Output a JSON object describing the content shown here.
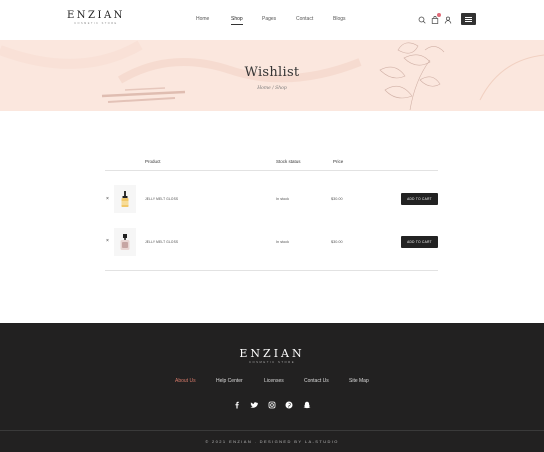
{
  "header": {
    "logo": "ENZIAN",
    "logo_tagline": "COSMETIC STORE",
    "nav": [
      "Home",
      "Shop",
      "Pages",
      "Contact",
      "Blogs"
    ],
    "active_nav": "Shop",
    "icons": [
      "search-icon",
      "cart-icon",
      "user-icon",
      "menu-icon"
    ]
  },
  "banner": {
    "title": "Wishlist",
    "breadcrumb": "Home / Shop"
  },
  "table": {
    "headers": {
      "product": "Product",
      "stock": "Stock status",
      "price": "Price"
    },
    "rows": [
      {
        "remove": "×",
        "name": "JELLY MELT GLOSS",
        "stock": "In stock",
        "price": "$30.00",
        "button": "ADD TO CART"
      },
      {
        "remove": "×",
        "name": "JELLY MELT GLOSS",
        "stock": "In stock",
        "price": "$30.00",
        "button": "ADD TO CART"
      }
    ]
  },
  "footer": {
    "logo": "ENZIAN",
    "logo_tagline": "COSMETIC STORE",
    "links": [
      "About Us",
      "Help Center",
      "Licenses",
      "Contact Us",
      "Site Map"
    ],
    "active_link": "About Us",
    "social_icons": [
      "facebook-icon",
      "twitter-icon",
      "instagram-icon",
      "pinterest-icon",
      "snapchat-icon"
    ],
    "copyright": "© 2021 ENZIAN . DESIGNED BY LA-STUDIO"
  },
  "colors": {
    "banner_bg": "#fbe7de",
    "footer_bg": "#222121",
    "accent": "#d77a6a",
    "badge": "#e06a78"
  }
}
